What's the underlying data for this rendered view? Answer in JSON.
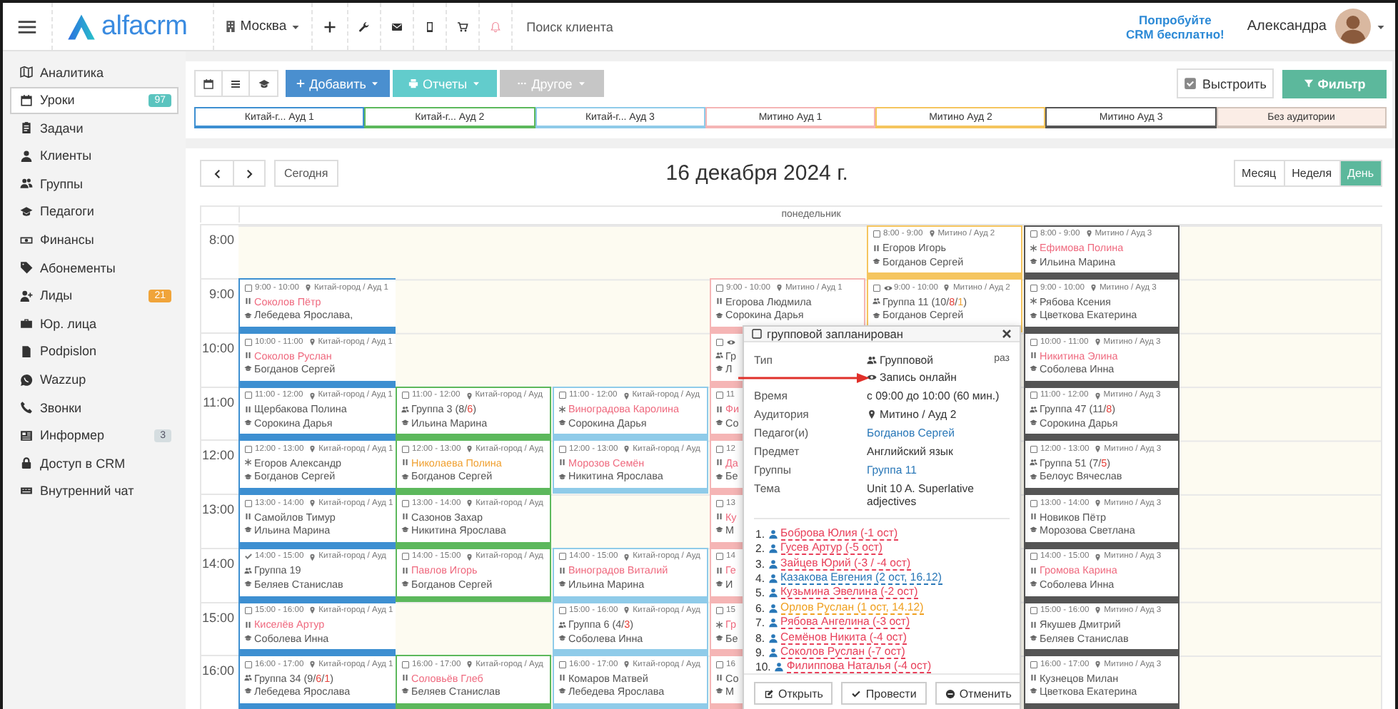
{
  "topbar": {
    "brand": "alfacrm",
    "branch": "Москва",
    "search": {
      "placeholder": "Поиск клиента"
    },
    "promo": [
      "Попробуйте",
      "CRM бесплатно!"
    ],
    "user": "Александра"
  },
  "sidebar": {
    "items": [
      {
        "label": "Аналитика",
        "selected": false
      },
      {
        "label": "Уроки",
        "selected": true,
        "badge": "97",
        "color": "#5bc4bf"
      },
      {
        "label": "Задачи",
        "selected": false
      },
      {
        "label": "Клиенты",
        "selected": false
      },
      {
        "label": "Группы",
        "selected": false
      },
      {
        "label": "Педагоги",
        "selected": false
      },
      {
        "label": "Финансы",
        "selected": false
      },
      {
        "label": "Абонементы",
        "selected": false
      },
      {
        "label": "Лиды",
        "selected": false,
        "badge": "21",
        "color": "#f0a43a"
      },
      {
        "label": "Юр. лица",
        "selected": false
      },
      {
        "label": "Podpislon",
        "selected": false
      },
      {
        "label": "Wazzup",
        "selected": false
      },
      {
        "label": "Звонки",
        "selected": false
      },
      {
        "label": "Информер",
        "selected": false,
        "badge": "3",
        "color": "#d5dde0"
      },
      {
        "label": "Доступ в CRM",
        "selected": false
      },
      {
        "label": "Внутренний чат",
        "selected": false
      }
    ]
  },
  "toolbar": {
    "actions": [
      {
        "label": "Добавить",
        "kind": "primary"
      },
      {
        "label": "Отчеты",
        "kind": "info"
      },
      {
        "label": "Другое",
        "kind": "muted"
      }
    ],
    "arrange": {
      "label": "Выстроить",
      "checked": true
    },
    "filter": "Фильтр",
    "rooms": [
      {
        "label": "Китай-г... Ауд 1",
        "color": "#3d8fd1",
        "kind": "room"
      },
      {
        "label": "Китай-г... Ауд 2",
        "color": "#5cb85c",
        "kind": "room"
      },
      {
        "label": "Китай-г... Ауд 3",
        "color": "#8fcbe9",
        "kind": "room"
      },
      {
        "label": "Митино Ауд 1",
        "color": "#f5b5b5",
        "kind": "room"
      },
      {
        "label": "Митино Ауд 2",
        "color": "#f5c55e",
        "kind": "room"
      },
      {
        "label": "Митино Ауд 3",
        "color": "#555555",
        "kind": "room"
      },
      {
        "label": "Без аудитории",
        "color": "#d2c4bb",
        "kind": "none"
      }
    ]
  },
  "calendar": {
    "today": "Сегодня",
    "title": "16 декабря 2024 г.",
    "views": [
      {
        "label": "Месяц",
        "selected": false
      },
      {
        "label": "Неделя",
        "selected": false
      },
      {
        "label": "День",
        "selected": true
      }
    ],
    "day": "понедельник",
    "hours": [
      "8:00",
      "9:00",
      "10:00",
      "11:00",
      "12:00",
      "13:00",
      "14:00",
      "15:00",
      "16:00"
    ],
    "columns": [
      {
        "slots": [
          {
            "kind": "free"
          },
          {
            "kind": "individual",
            "done": false,
            "online": false,
            "time": "9:00 - 10:00",
            "place": "Китай-город / Ауд 1",
            "name": [
              {
                "text": "Соколов Пётр",
                "color": "#ef6a7f"
              }
            ],
            "teacher": "Лебедева Ярослава,"
          },
          {
            "kind": "individual",
            "done": false,
            "online": false,
            "time": "10:00 - 11:00",
            "place": "Китай-город / Ауд 1",
            "name": [
              {
                "text": "Соколов Руслан",
                "color": "#ef6a7f"
              }
            ],
            "teacher": "Богданов Сергей"
          },
          {
            "kind": "individual",
            "done": false,
            "online": false,
            "time": "11:00 - 12:00",
            "place": "Китай-город / Ауд 1",
            "name": [
              {
                "text": "Щербакова Полина",
                "color": "#555555"
              }
            ],
            "teacher": "Сорокина Дарья"
          },
          {
            "kind": "trial",
            "done": false,
            "online": false,
            "time": "12:00 - 13:00",
            "place": "Китай-город / Ауд 1",
            "name": [
              {
                "text": "Егоров Александр",
                "color": "#555555"
              }
            ],
            "teacher": "Богданов Сергей"
          },
          {
            "kind": "individual",
            "done": false,
            "online": false,
            "time": "13:00 - 14:00",
            "place": "Китай-город / Ауд 1",
            "name": [
              {
                "text": "Самойлов Тимур",
                "color": "#555555"
              }
            ],
            "teacher": "Ильина Марина"
          },
          {
            "kind": "group",
            "done": true,
            "online": false,
            "time": "14:00 - 15:00",
            "place": "Китай-город / Ауд",
            "name": [
              {
                "text": "Группа 19",
                "color": "#555555"
              }
            ],
            "teacher": "Беляев Станислав"
          },
          {
            "kind": "individual",
            "done": false,
            "online": false,
            "time": "15:00 - 16:00",
            "place": "Китай-город / Ауд 1",
            "name": [
              {
                "text": "Киселёв Артур",
                "color": "#ef6a7f"
              }
            ],
            "teacher": "Соболева Инна"
          },
          {
            "kind": "group",
            "done": false,
            "online": false,
            "time": "16:00 - 17:00",
            "place": "Китай-город / Ауд 1",
            "name": [
              {
                "text": "Группа 34 (9/",
                "color": "#555555"
              },
              {
                "text": "6",
                "color": "#e5413a"
              },
              {
                "text": "/",
                "color": "#555555"
              },
              {
                "text": "1",
                "color": "#e5413a"
              },
              {
                "text": ")",
                "color": "#555555"
              }
            ],
            "teacher": "Лебедева Ярослава"
          }
        ]
      },
      {
        "slots": [
          {
            "kind": "free"
          },
          {
            "kind": "free"
          },
          {
            "kind": "free"
          },
          {
            "kind": "group",
            "done": false,
            "online": false,
            "time": "11:00 - 12:00",
            "place": "Китай-город / Ауд",
            "name": [
              {
                "text": "Группа 3 (8/",
                "color": "#555555"
              },
              {
                "text": "6",
                "color": "#e5413a"
              },
              {
                "text": ")",
                "color": "#555555"
              }
            ],
            "teacher": "Ильина Марина"
          },
          {
            "kind": "individual",
            "done": false,
            "online": false,
            "time": "12:00 - 13:00",
            "place": "Китай-город / Ауд",
            "name": [
              {
                "text": "Николаева Полина",
                "color": "#f0a030"
              }
            ],
            "teacher": "Богданов Сергей"
          },
          {
            "kind": "individual",
            "done": false,
            "online": false,
            "time": "13:00 - 14:00",
            "place": "Китай-город / Ауд",
            "name": [
              {
                "text": "Сазонов Захар",
                "color": "#555555"
              }
            ],
            "teacher": "Никитина Ярослава"
          },
          {
            "kind": "individual",
            "done": false,
            "online": false,
            "time": "14:00 - 15:00",
            "place": "Китай-город / Ауд",
            "name": [
              {
                "text": "Павлов Игорь",
                "color": "#ef6a7f"
              }
            ],
            "teacher": "Богданов Сергей"
          },
          {
            "kind": "free"
          },
          {
            "kind": "individual",
            "done": false,
            "online": false,
            "time": "16:00 - 17:00",
            "place": "Китай-город / Ауд",
            "name": [
              {
                "text": "Соловьёв Глеб",
                "color": "#ef6a7f"
              }
            ],
            "teacher": "Беляев Станислав"
          }
        ]
      },
      {
        "slots": [
          {
            "kind": "free"
          },
          {
            "kind": "free"
          },
          {
            "kind": "free"
          },
          {
            "kind": "trial",
            "done": false,
            "online": false,
            "time": "11:00 - 12:00",
            "place": "Китай-город / Ауд",
            "name": [
              {
                "text": "Виноградова Каролина",
                "color": "#ef6a7f"
              }
            ],
            "teacher": "Сорокина Дарья"
          },
          {
            "kind": "individual",
            "done": false,
            "online": false,
            "time": "12:00 - 13:00",
            "place": "Китай-город / Ауд",
            "name": [
              {
                "text": "Морозов Семён",
                "color": "#ef6a7f"
              }
            ],
            "teacher": "Никитина Ярослава"
          },
          {
            "kind": "free"
          },
          {
            "kind": "individual",
            "done": false,
            "online": false,
            "time": "14:00 - 15:00",
            "place": "Китай-город / Ауд",
            "name": [
              {
                "text": "Виноградов Виталий",
                "color": "#ef6a7f"
              }
            ],
            "teacher": "Ильина Марина"
          },
          {
            "kind": "group",
            "done": false,
            "online": false,
            "time": "15:00 - 16:00",
            "place": "Китай-город / Ауд",
            "name": [
              {
                "text": "Группа 6 (4/",
                "color": "#555555"
              },
              {
                "text": "3",
                "color": "#e5413a"
              },
              {
                "text": ")",
                "color": "#555555"
              }
            ],
            "teacher": "Соболева Инна"
          },
          {
            "kind": "individual",
            "done": false,
            "online": false,
            "time": "16:00 - 17:00",
            "place": "Китай-город / Ауд",
            "name": [
              {
                "text": "Комаров Матвей",
                "color": "#555555"
              }
            ],
            "teacher": "Лебедева Ярослава"
          }
        ]
      },
      {
        "slots": [
          {
            "kind": "free"
          },
          {
            "kind": "individual",
            "done": false,
            "online": false,
            "time": "9:00 - 10:00",
            "place": "Митино / Ауд 1",
            "name": [
              {
                "text": "Егорова Людмила",
                "color": "#555555"
              }
            ],
            "teacher": "Сорокина Дарья"
          },
          {
            "kind": "group",
            "done": false,
            "online": true,
            "name": [
              {
                "text": "Гр",
                "color": "#555555"
              }
            ],
            "teacher": "Л"
          },
          {
            "kind": "individual",
            "done": false,
            "online": false,
            "time": "11",
            "name": [
              {
                "text": "Фи",
                "color": "#ef6a7f"
              }
            ],
            "teacher": "Со"
          },
          {
            "kind": "individual",
            "done": false,
            "online": false,
            "time": "12",
            "name": [
              {
                "text": "Да",
                "color": "#ef6a7f"
              }
            ],
            "teacher": "Бе"
          },
          {
            "kind": "individual",
            "done": false,
            "online": false,
            "time": "13",
            "name": [
              {
                "text": "Ку",
                "color": "#ef6a7f"
              }
            ],
            "teacher": "М"
          },
          {
            "kind": "individual",
            "done": false,
            "online": false,
            "time": "14",
            "name": [
              {
                "text": "Ге",
                "color": "#ef6a7f"
              }
            ],
            "teacher": "И"
          },
          {
            "kind": "trial",
            "done": false,
            "online": false,
            "time": "15",
            "name": [
              {
                "text": "Гр",
                "color": "#ef6a7f"
              }
            ],
            "teacher": "Бе"
          },
          {
            "kind": "individual",
            "done": false,
            "online": false,
            "time": "16",
            "name": [
              {
                "text": "Со",
                "color": "#555555"
              }
            ],
            "teacher": "М"
          }
        ]
      },
      {
        "slots": [
          {
            "kind": "individual",
            "done": false,
            "online": false,
            "time": "8:00 - 9:00",
            "place": "Митино / Ауд 2",
            "name": [
              {
                "text": "Егоров Игорь",
                "color": "#555555"
              }
            ],
            "teacher": "Богданов Сергей"
          },
          {
            "kind": "group",
            "done": false,
            "online": true,
            "time": "9:00 - 10:00",
            "place": "Митино / Ауд 2",
            "name": [
              {
                "text": "Группа 11 (10/",
                "color": "#555555"
              },
              {
                "text": "8",
                "color": "#e5413a"
              },
              {
                "text": "/",
                "color": "#555555"
              },
              {
                "text": "1",
                "color": "#f0a030"
              },
              {
                "text": ")",
                "color": "#555555"
              }
            ],
            "teacher": "Богданов Сергей"
          }
        ]
      },
      {
        "slots": [
          {
            "kind": "trial",
            "done": false,
            "online": false,
            "time": "8:00 - 9:00",
            "place": "Митино / Ауд 3",
            "name": [
              {
                "text": "Ефимова Полина",
                "color": "#ef6a7f"
              }
            ],
            "teacher": "Ильина Марина"
          },
          {
            "kind": "trial",
            "done": false,
            "online": false,
            "time": "9:00 - 10:00",
            "place": "Митино / Ауд 3",
            "name": [
              {
                "text": "Рябова Ксения",
                "color": "#555555"
              }
            ],
            "teacher": "Цветкова Екатерина"
          },
          {
            "kind": "individual",
            "done": false,
            "online": false,
            "time": "10:00 - 11:00",
            "place": "Митино / Ауд 3",
            "name": [
              {
                "text": "Никитина Элина",
                "color": "#ef6a7f"
              }
            ],
            "teacher": "Соболева Инна"
          },
          {
            "kind": "group",
            "done": false,
            "online": false,
            "time": "11:00 - 12:00",
            "place": "Митино / Ауд 3",
            "name": [
              {
                "text": "Группа 47 (11/",
                "color": "#555555"
              },
              {
                "text": "8",
                "color": "#e5413a"
              },
              {
                "text": ")",
                "color": "#555555"
              }
            ],
            "teacher": "Сорокина Дарья"
          },
          {
            "kind": "group",
            "done": false,
            "online": false,
            "time": "12:00 - 13:00",
            "place": "Митино / Ауд 3",
            "name": [
              {
                "text": "Группа 51 (7/",
                "color": "#555555"
              },
              {
                "text": "5",
                "color": "#e5413a"
              },
              {
                "text": ")",
                "color": "#555555"
              }
            ],
            "teacher": "Белоус Вячеслав"
          },
          {
            "kind": "individual",
            "done": false,
            "online": false,
            "time": "13:00 - 14:00",
            "place": "Митино / Ауд 3",
            "name": [
              {
                "text": "Новиков Пётр",
                "color": "#555555"
              }
            ],
            "teacher": "Морозова Светлана"
          },
          {
            "kind": "individual",
            "done": false,
            "online": false,
            "time": "14:00 - 15:00",
            "place": "Митино / Ауд 3",
            "name": [
              {
                "text": "Громова Карина",
                "color": "#ef6a7f"
              }
            ],
            "teacher": "Соболева Инна"
          },
          {
            "kind": "individual",
            "done": false,
            "online": false,
            "time": "15:00 - 16:00",
            "place": "Митино / Ауд 3",
            "name": [
              {
                "text": "Якушев Дмитрий",
                "color": "#555555"
              }
            ],
            "teacher": "Беляев Станислав"
          },
          {
            "kind": "individual",
            "done": false,
            "online": false,
            "time": "16:00 - 17:00",
            "place": "Митино / Ауд 3",
            "name": [
              {
                "text": "Кузнецов Милан",
                "color": "#555555"
              }
            ],
            "teacher": "Цветкова Екатерина"
          }
        ]
      }
    ]
  },
  "popup": {
    "title": "групповой запланирован",
    "note": "раз",
    "fields": [
      {
        "label": "Тип",
        "lines": [
          {
            "text": "Групповой",
            "kind": "group"
          },
          {
            "text": "Запись онлайн",
            "kind": "online"
          }
        ]
      },
      {
        "label": "Время",
        "lines": [
          {
            "text": "с 09:00 до 10:00 (60 мин.)",
            "kind": "plain"
          }
        ]
      },
      {
        "label": "Аудитория",
        "lines": [
          {
            "text": "Митино / Ауд 2",
            "kind": "place"
          }
        ]
      },
      {
        "label": "Педагог(и)",
        "lines": [
          {
            "text": "Богданов Сергей",
            "kind": "link"
          }
        ]
      },
      {
        "label": "Предмет",
        "lines": [
          {
            "text": "Английский язык",
            "kind": "plain"
          }
        ]
      },
      {
        "label": "Группы",
        "lines": [
          {
            "text": "Группа 11",
            "kind": "link"
          }
        ]
      },
      {
        "label": "Тема",
        "lines": [
          {
            "text": "Unit 10 A. Superlative adjectives",
            "kind": "plain"
          }
        ]
      }
    ],
    "students": [
      {
        "number": "1.",
        "name": "Боброва Юлия (-1 ост)",
        "color": "#e8405a"
      },
      {
        "number": "2.",
        "name": "Гусев Артур (-5 ост)",
        "color": "#e8405a"
      },
      {
        "number": "3.",
        "name": "Зайцев Юрий (-3 / -4 ост)",
        "color": "#e8405a"
      },
      {
        "number": "4.",
        "name": "Казакова Евгения (2 ост, 16.12)",
        "color": "#2a78b8"
      },
      {
        "number": "5.",
        "name": "Кузьмина Эвелина (-2 ост)",
        "color": "#e8405a"
      },
      {
        "number": "6.",
        "name": "Орлов Руслан (1 ост, 14.12)",
        "color": "#f0a020"
      },
      {
        "number": "7.",
        "name": "Рябова Ангелина (-3 ост)",
        "color": "#e8405a"
      },
      {
        "number": "8.",
        "name": "Семёнов Никита (-4 ост)",
        "color": "#e8405a"
      },
      {
        "number": "9.",
        "name": "Соколов Руслан (-7 ост)",
        "color": "#e8405a"
      },
      {
        "number": "10.",
        "name": "Филиппова Наталья (-4 ост)",
        "color": "#e8405a"
      }
    ],
    "buttons": [
      "Открыть",
      "Провести",
      "Отменить"
    ]
  }
}
